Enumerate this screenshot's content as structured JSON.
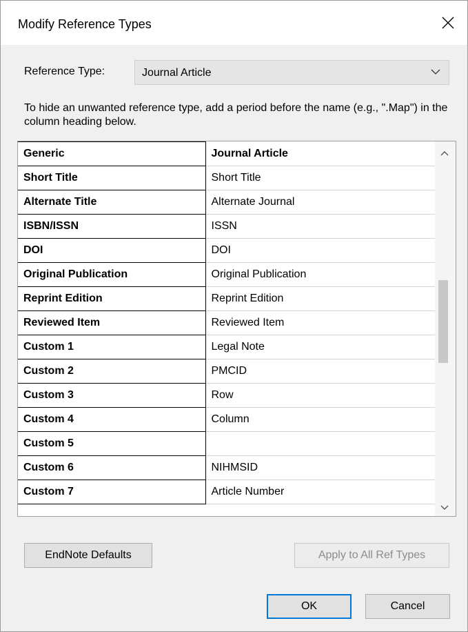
{
  "window": {
    "title": "Modify Reference Types"
  },
  "reference_type": {
    "label": "Reference Type:",
    "selected": "Journal Article"
  },
  "help_text": "To hide an unwanted reference type, add a period before the name (e.g., \".Map\") in the column heading below.",
  "grid": {
    "header": {
      "field": "Generic",
      "value": "Journal Article"
    },
    "rows": [
      {
        "field": "Short Title",
        "value": "Short Title"
      },
      {
        "field": "Alternate Title",
        "value": "Alternate Journal"
      },
      {
        "field": "ISBN/ISSN",
        "value": "ISSN"
      },
      {
        "field": "DOI",
        "value": "DOI"
      },
      {
        "field": "Original Publication",
        "value": "Original Publication"
      },
      {
        "field": "Reprint Edition",
        "value": "Reprint Edition"
      },
      {
        "field": "Reviewed Item",
        "value": "Reviewed Item"
      },
      {
        "field": "Custom 1",
        "value": "Legal Note"
      },
      {
        "field": "Custom 2",
        "value": "PMCID"
      },
      {
        "field": "Custom 3",
        "value": "Row"
      },
      {
        "field": "Custom 4",
        "value": "Column"
      },
      {
        "field": "Custom 5",
        "value": ""
      },
      {
        "field": "Custom 6",
        "value": "NIHMSID"
      },
      {
        "field": "Custom 7",
        "value": "Article Number"
      }
    ]
  },
  "buttons": {
    "defaults": "EndNote Defaults",
    "apply_all": "Apply to All Ref Types",
    "ok": "OK",
    "cancel": "Cancel"
  },
  "icons": {
    "close": "close-icon",
    "dropdown": "chevron-down-icon",
    "scroll_up": "chevron-up-icon",
    "scroll_down": "chevron-down-icon"
  }
}
